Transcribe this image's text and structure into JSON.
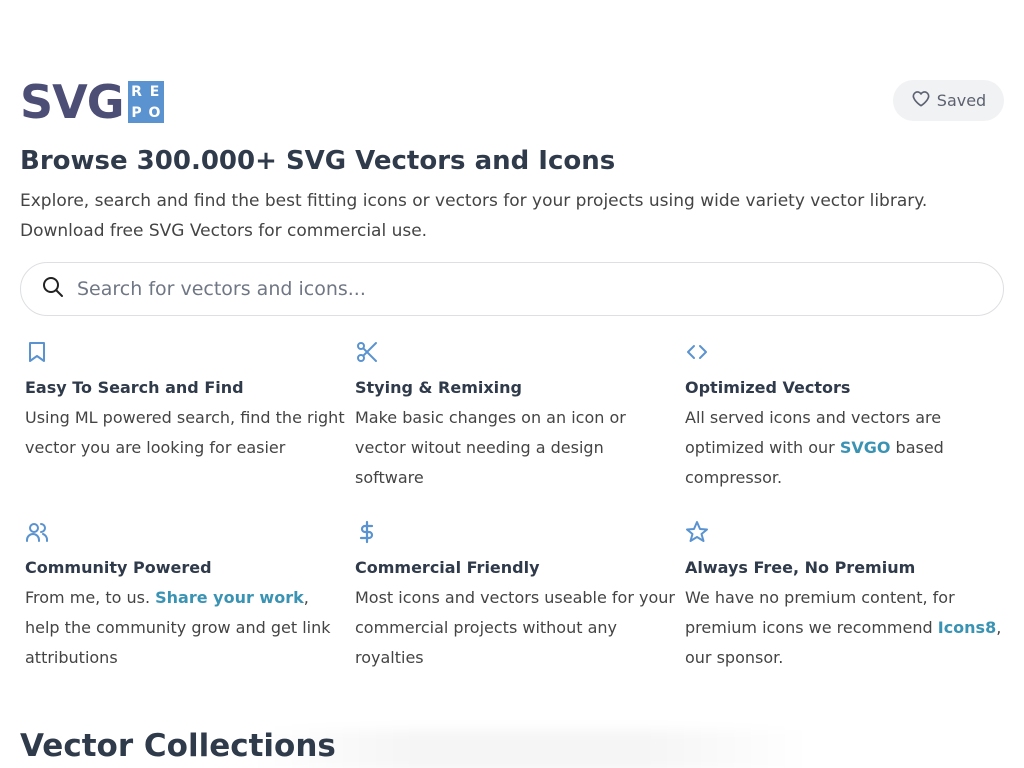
{
  "logo": {
    "main": "SVG",
    "box": [
      "R",
      "E",
      "P",
      "O"
    ]
  },
  "header": {
    "saved_label": "Saved"
  },
  "hero": {
    "title": "Browse 300.000+ SVG Vectors and Icons",
    "desc_line1": "Explore, search and find the best fitting icons or vectors for your projects using wide variety vector library.",
    "desc_line2": "Download free SVG Vectors for commercial use."
  },
  "search": {
    "placeholder": "Search for vectors and icons..."
  },
  "features": [
    {
      "icon": "bookmark-icon",
      "title": "Easy To Search and Find",
      "text": "Using ML powered search, find the right vector you are looking for easier"
    },
    {
      "icon": "scissors-icon",
      "title": "Stying & Remixing",
      "text": "Make basic changes on an icon or vector witout needing a design software"
    },
    {
      "icon": "code-icon",
      "title": "Optimized Vectors",
      "text_before": "All served icons and vectors are optimized with our ",
      "link": "SVGO",
      "text_after": " based compressor."
    },
    {
      "icon": "users-icon",
      "title": "Community Powered",
      "text_before": "From me, to us. ",
      "link": "Share your work",
      "text_after": ", help the community grow and get link attributions"
    },
    {
      "icon": "dollar-icon",
      "title": "Commercial Friendly",
      "text": "Most icons and vectors useable for your commercial projects without any royalties"
    },
    {
      "icon": "star-icon",
      "title": "Always Free, No Premium",
      "text_before": "We have no premium content, for premium icons we recommend ",
      "link": "Icons8",
      "text_after": ", our sponsor."
    }
  ],
  "collections": {
    "title": "Vector Collections"
  },
  "colors": {
    "accent": "#5a93d0",
    "link": "#3b93b4",
    "logo_text": "#4d4e75"
  }
}
